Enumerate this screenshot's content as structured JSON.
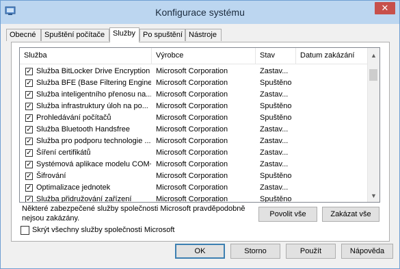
{
  "window": {
    "title": "Konfigurace systému",
    "close_glyph": "✕"
  },
  "tabs": [
    {
      "label": "Obecné"
    },
    {
      "label": "Spuštění počítače"
    },
    {
      "label": "Služby"
    },
    {
      "label": "Po spuštění"
    },
    {
      "label": "Nástroje"
    }
  ],
  "table": {
    "columns": [
      "Služba",
      "Výrobce",
      "Stav",
      "Datum zakázání"
    ],
    "rows": [
      {
        "name": "Služba BitLocker Drive Encryption",
        "vendor": "Microsoft Corporation",
        "status": "Zastav...",
        "checked": "✓"
      },
      {
        "name": "Služba BFE (Base Filtering Engine)",
        "vendor": "Microsoft Corporation",
        "status": "Spuštěno",
        "checked": "✓"
      },
      {
        "name": "Služba inteligentního přenosu na...",
        "vendor": "Microsoft Corporation",
        "status": "Zastav...",
        "checked": "✓"
      },
      {
        "name": "Služba infrastruktury úloh na po...",
        "vendor": "Microsoft Corporation",
        "status": "Spuštěno",
        "checked": "✓"
      },
      {
        "name": "Prohledávání počítačů",
        "vendor": "Microsoft Corporation",
        "status": "Spuštěno",
        "checked": "✓"
      },
      {
        "name": "Služba Bluetooth Handsfree",
        "vendor": "Microsoft Corporation",
        "status": "Zastav...",
        "checked": "✓"
      },
      {
        "name": "Služba pro podporu technologie ...",
        "vendor": "Microsoft Corporation",
        "status": "Zastav...",
        "checked": "✓"
      },
      {
        "name": "Šíření certifikátů",
        "vendor": "Microsoft Corporation",
        "status": "Zastav...",
        "checked": "✓"
      },
      {
        "name": "Systémová aplikace modelu COM+",
        "vendor": "Microsoft Corporation",
        "status": "Zastav...",
        "checked": "✓"
      },
      {
        "name": "Šifrování",
        "vendor": "Microsoft Corporation",
        "status": "Spuštěno",
        "checked": "✓"
      },
      {
        "name": "Optimalizace jednotek",
        "vendor": "Microsoft Corporation",
        "status": "Zastav...",
        "checked": "✓"
      },
      {
        "name": "Služba přidružování zařízení",
        "vendor": "Microsoft Corporation",
        "status": "Spuštěno",
        "checked": "✓"
      }
    ]
  },
  "scrollbar": {
    "up_glyph": "▲",
    "down_glyph": "▼"
  },
  "note": "Některé zabezpečené služby společnosti Microsoft pravděpodobně nejsou zakázány.",
  "buttons": {
    "enable_all": "Povolit vše",
    "disable_all": "Zakázat vše",
    "ok": "OK",
    "cancel": "Storno",
    "apply": "Použít",
    "help": "Nápověda"
  },
  "hide_ms": {
    "label": "Skrýt všechny služby společnosti Microsoft"
  },
  "colors": {
    "titlebar": "#bcd6f0",
    "close": "#c7504b",
    "default_border": "#3c7fb1"
  }
}
